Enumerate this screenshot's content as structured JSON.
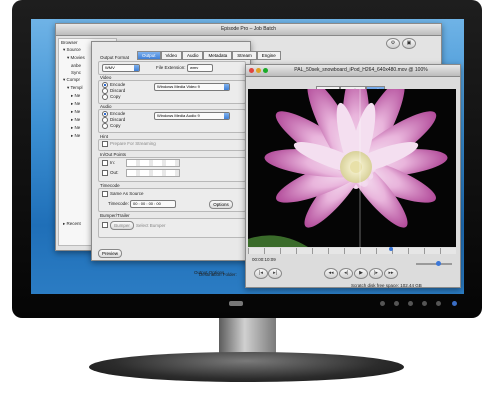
{
  "bg_window": {
    "title": "Episode Pro – Job Batch",
    "sidebar_header": "Browser",
    "tree": [
      "Source",
      "Movies",
      "anbe",
      "Sync",
      "Compr",
      "Templ",
      "Ne",
      "Ne",
      "Ne",
      "Ne",
      "Ne",
      "Ne",
      "Recent"
    ]
  },
  "settings_window": {
    "tabs": [
      "Output",
      "Video",
      "Audio",
      "Metadata",
      "Stream",
      "Engine"
    ],
    "output_format_label": "Output Format",
    "format_value": "WMV",
    "file_extension_label": "File Extension:",
    "file_extension_value": "wmv",
    "video_label": "Video",
    "video_options": [
      "Encode",
      "Discard",
      "Copy"
    ],
    "video_codec": "Windows Media Video 9",
    "audio_label": "Audio",
    "audio_options": [
      "Encode",
      "Discard",
      "Copy"
    ],
    "audio_codec": "Windows Media Audio 9",
    "hint_label": "Hint",
    "prepare_streaming": "Prepare For Streaming",
    "inout_label": "In/Out Points",
    "in_label": "In:",
    "out_label": "Out:",
    "timecode_label": "Timecode",
    "same_as_source": "Same As Source",
    "timecode_field_label": "Timecode:",
    "timecode_value": "00 : 00 : 00 : 00",
    "options_button": "Options",
    "bumper_label": "Bumper/Trailer",
    "bumper_button": "Bumper",
    "select_bumper": "Select Bumper",
    "preview_button": "Preview",
    "output_options": "Output Options",
    "destination_label": "Destination Folder:"
  },
  "preview_window": {
    "title": "PAL_50sek_snowboard_iPod_H264_640x480.mov @ 100%",
    "tabs": [
      "Source",
      "Preview",
      "Split"
    ],
    "timecode": "00:00:10:09",
    "status": "Scratch disk free space: 102.44 GB"
  }
}
